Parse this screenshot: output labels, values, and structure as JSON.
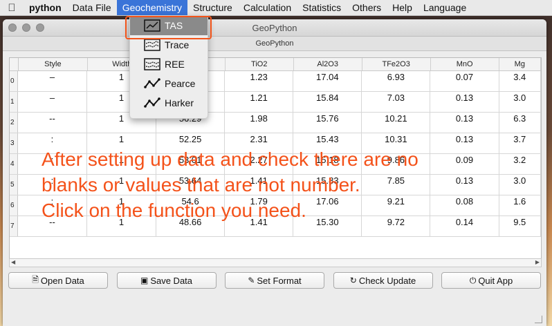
{
  "menubar": {
    "items": [
      "python",
      "Data File",
      "Geochemistry",
      "Structure",
      "Calculation",
      "Statistics",
      "Others",
      "Help",
      "Language"
    ]
  },
  "window": {
    "title": "GeoPython",
    "subtitle": "GeoPython"
  },
  "table": {
    "columns": [
      "Style",
      "Width",
      "",
      "TiO2",
      "Al2O3",
      "TFe2O3",
      "MnO",
      "Mg"
    ],
    "rows": [
      {
        "index": "0",
        "cells": [
          "–",
          "1",
          "",
          "1.23",
          "17.04",
          "6.93",
          "0.07",
          "3.4"
        ]
      },
      {
        "index": "1",
        "cells": [
          "–",
          "1",
          "",
          "1.21",
          "15.84",
          "7.03",
          "0.13",
          "3.0"
        ]
      },
      {
        "index": "2",
        "cells": [
          "--",
          "1",
          "56.29",
          "1.98",
          "15.76",
          "10.21",
          "0.13",
          "6.3"
        ]
      },
      {
        "index": "3",
        "cells": [
          ":",
          "1",
          "52.25",
          "2.31",
          "15.43",
          "10.31",
          "0.13",
          "3.7"
        ]
      },
      {
        "index": "4",
        "cells": [
          ":",
          "1",
          "53.01",
          "2.27",
          "15.18",
          "9.86",
          "0.09",
          "3.2"
        ]
      },
      {
        "index": "5",
        "cells": [
          ":",
          "1",
          "53.64",
          "1.41",
          "15.83",
          "7.85",
          "0.13",
          "3.0"
        ]
      },
      {
        "index": "6",
        "cells": [
          ":",
          "1",
          "54.6",
          "1.79",
          "17.06",
          "9.21",
          "0.08",
          "1.6"
        ]
      },
      {
        "index": "7",
        "cells": [
          "--",
          "1",
          "48.66",
          "1.41",
          "15.30",
          "9.72",
          "0.14",
          "9.5"
        ]
      }
    ]
  },
  "buttons": {
    "open": "Open Data",
    "save": "Save Data",
    "format": "Set Format",
    "update": "Check Update",
    "quit": "Quit App"
  },
  "dropdown": {
    "items": [
      "TAS",
      "Trace",
      "REE",
      "Pearce",
      "Harker"
    ]
  },
  "annotation": {
    "line1": "After setting up data and check there are no",
    "line2": "blanks or values that are not number.",
    "line3": "Click on the function you need."
  },
  "colors": {
    "annotation": "#f4521a",
    "menu_active": "#3a74d8",
    "dropdown_highlight": "#8a8a8a"
  }
}
